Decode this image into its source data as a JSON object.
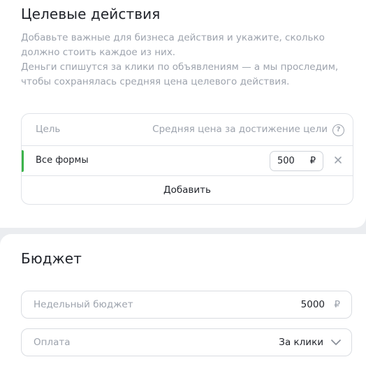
{
  "goals_section": {
    "title": "Целевые действия",
    "description_line1": "Добавьте важные для бизнеса действия и укажите, сколько должно стоить каждое из них.",
    "description_line2": "Деньги спишутся за клики по объявлениям — а мы проследим, чтобы сохранялась средняя цена целевого действия.",
    "table": {
      "col_goal": "Цель",
      "col_price": "Средняя цена за достижение цели",
      "help_icon": "?",
      "rows": [
        {
          "name": "Все формы",
          "price": "500",
          "currency": "₽"
        }
      ],
      "add_label": "Добавить"
    },
    "accent_color": "#3cb34a"
  },
  "budget_section": {
    "title": "Бюджет",
    "weekly_budget": {
      "label": "Недельный бюджет",
      "value": "5000",
      "currency": "₽"
    },
    "payment": {
      "label": "Оплата",
      "value": "За клики"
    }
  },
  "icons": {
    "help": "help-icon",
    "remove": "close-icon",
    "dropdown": "chevron-down-icon"
  }
}
